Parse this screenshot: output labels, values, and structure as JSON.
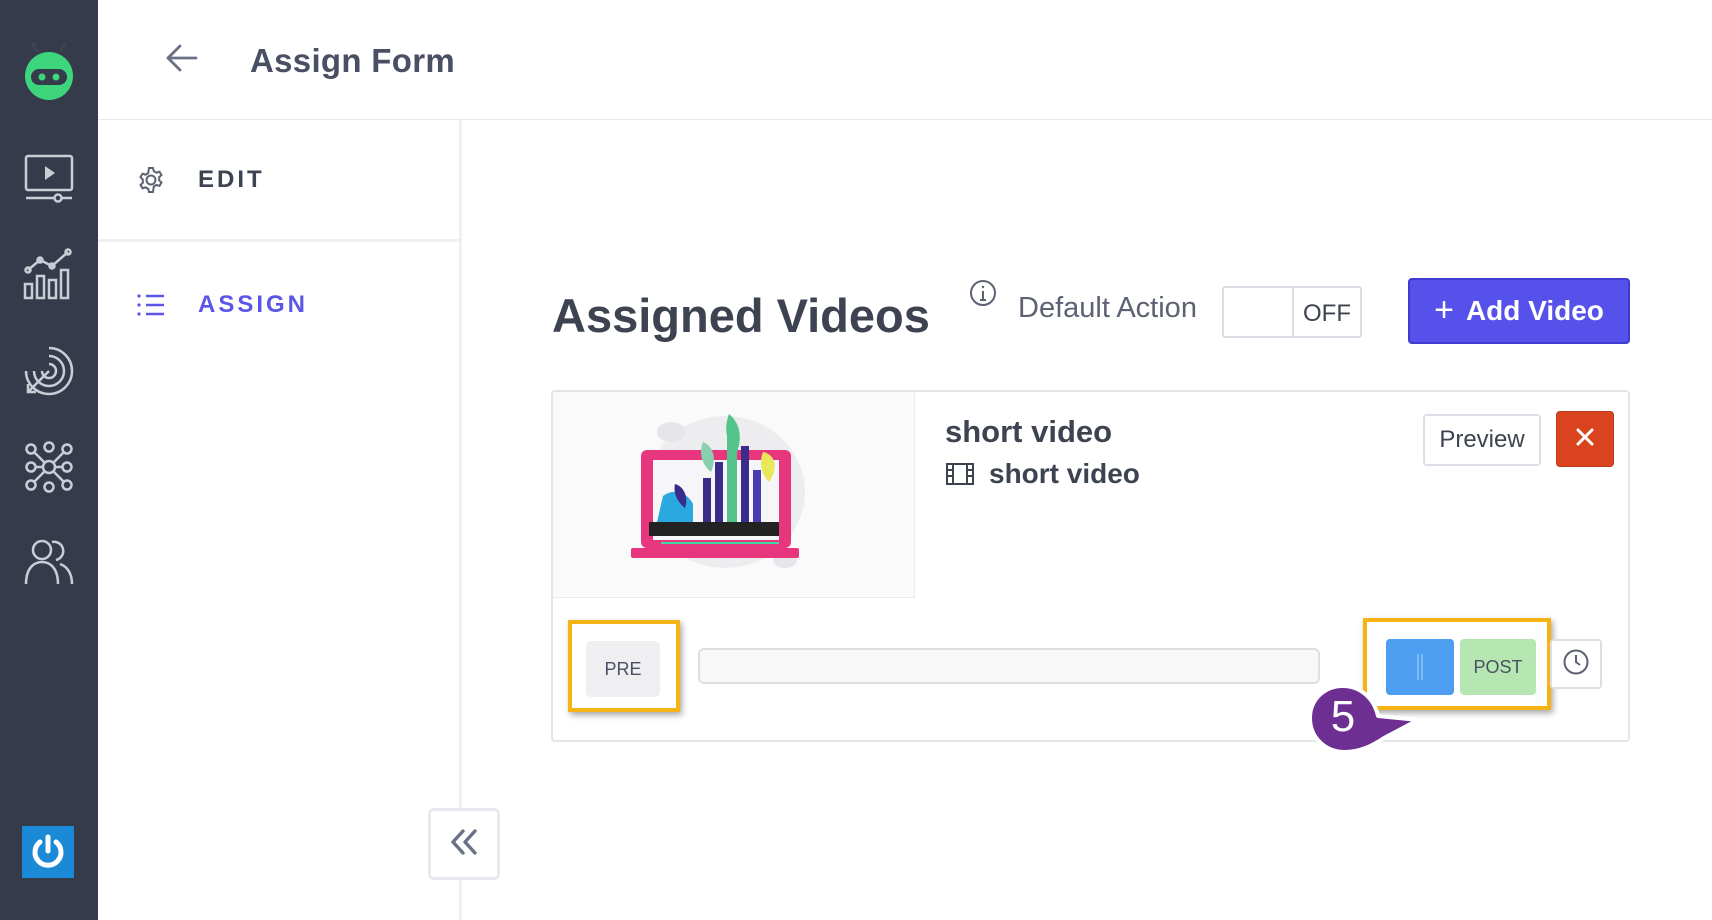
{
  "app": {
    "page_title": "Assign Form"
  },
  "rail": {
    "items": [
      {
        "icon": "video-player-icon"
      },
      {
        "icon": "analytics-chart-icon"
      },
      {
        "icon": "target-icon"
      },
      {
        "icon": "network-icon"
      },
      {
        "icon": "users-icon"
      }
    ],
    "power_icon": "power-icon",
    "colors": {
      "background": "#353b4a",
      "logo": "#3ed67c",
      "power": "#1a8ad6"
    }
  },
  "sidebar": {
    "edit_label": "EDIT",
    "assign_label": "ASSIGN",
    "active": "ASSIGN",
    "active_color": "#5b55e8"
  },
  "main": {
    "heading": "Assigned Videos",
    "default_action_label": "Default Action",
    "default_action_state": "OFF",
    "add_video_label": "Add Video",
    "accent_color": "#5651ea"
  },
  "video_card": {
    "title": "short video",
    "subtitle": "short video",
    "preview_label": "Preview",
    "delete_color": "#d9431e",
    "pre_label": "PRE",
    "post_label": "POST",
    "handle_color": "#4d9df0",
    "post_color": "#b6e7b2"
  },
  "annotation": {
    "step_number": "5",
    "highlight_color": "#f6b316",
    "callout_color": "#6e2f93"
  }
}
